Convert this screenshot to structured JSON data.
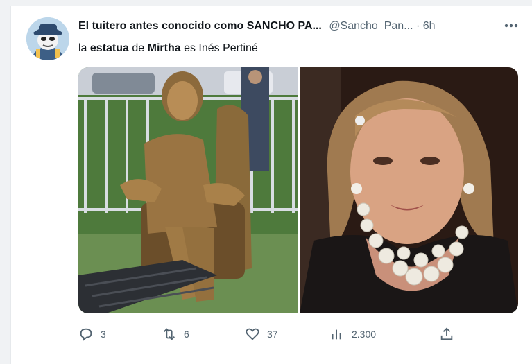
{
  "tweet": {
    "display_name": "El tuitero antes conocido como SANCHO PA...",
    "handle": "@Sancho_Pan...",
    "separator": "·",
    "time": "6h",
    "text_parts": [
      "la ",
      "estatua",
      " de ",
      "Mirtha",
      " es Inés Pertiné"
    ],
    "avatar_icon": "cartoon-avatar-icon",
    "more_icon": "more-dots-icon"
  },
  "media": {
    "left_image": "statue-photo",
    "right_image": "woman-portrait-photo"
  },
  "actions": {
    "replies": "3",
    "retweets": "6",
    "likes": "37",
    "views": "2.300"
  },
  "colors": {
    "text": "#0f1419",
    "secondary": "#536471",
    "background": "#f0f2f4"
  }
}
